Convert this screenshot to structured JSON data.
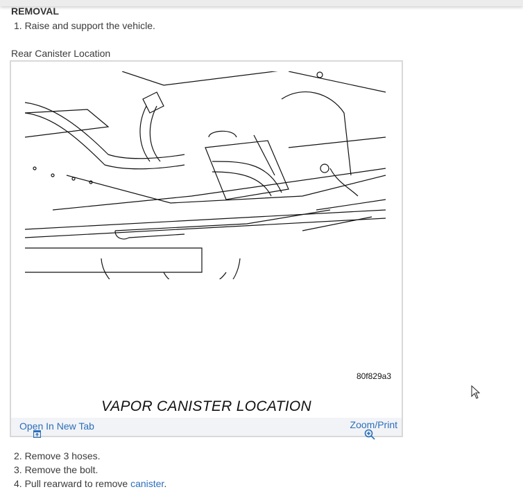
{
  "section": {
    "heading": "REMOVAL"
  },
  "steps_before": [
    {
      "text": "1. Raise and support the vehicle."
    }
  ],
  "figure": {
    "caption": "Rear Canister Location",
    "image_code": "80f829a3",
    "image_title": "VAPOR CANISTER LOCATION",
    "open_tab_label": "Open In New Tab",
    "zoom_print_label": "Zoom/Print"
  },
  "steps_after": [
    {
      "text": "2. Remove 3 hoses."
    },
    {
      "text": "3. Remove the bolt."
    },
    {
      "text": "4. Pull rearward to remove ",
      "link": "canister",
      "suffix": "."
    }
  ],
  "colors": {
    "link": "#2a6ebb",
    "footer_bg": "#f2f3f6"
  }
}
